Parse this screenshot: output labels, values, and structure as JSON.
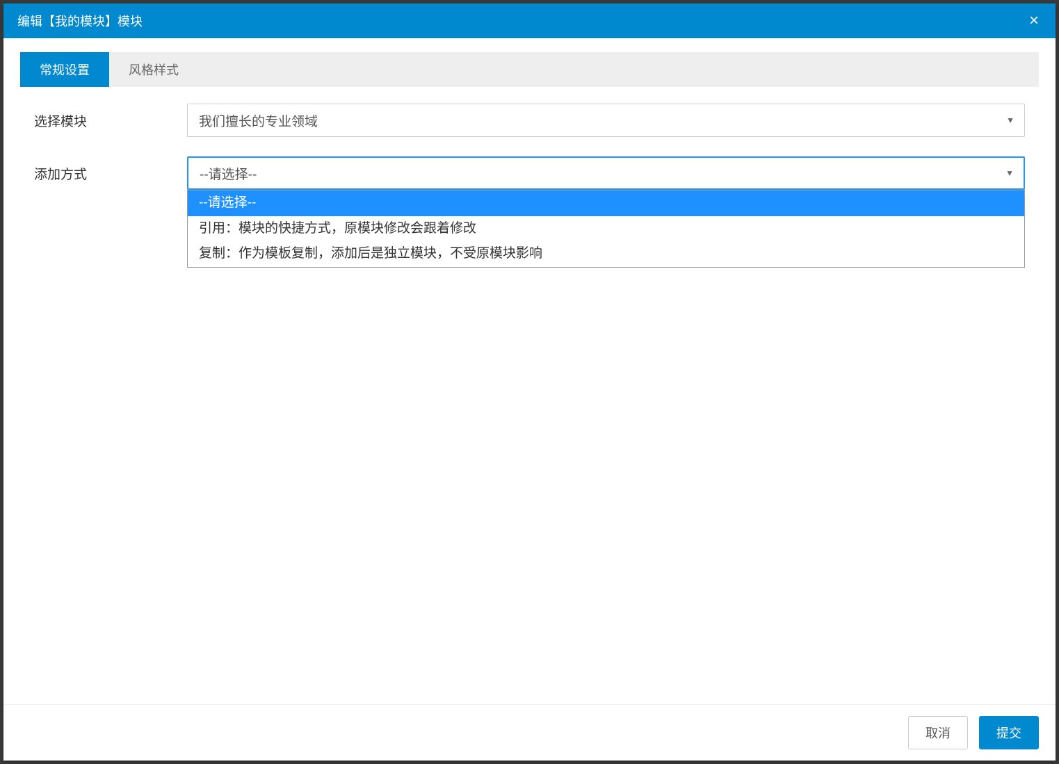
{
  "modal": {
    "title": "编辑【我的模块】模块",
    "close_icon": "×"
  },
  "tabs": [
    {
      "label": "常规设置",
      "active": true
    },
    {
      "label": "风格样式",
      "active": false
    }
  ],
  "form": {
    "select_module": {
      "label": "选择模块",
      "value": "我们擅长的专业领域"
    },
    "add_method": {
      "label": "添加方式",
      "value": "--请选择--",
      "options": [
        {
          "text": "--请选择--",
          "selected": true
        },
        {
          "text": "引用：模块的快捷方式，原模块修改会跟着修改",
          "selected": false
        },
        {
          "text": "复制：作为模板复制，添加后是独立模块，不受原模块影响",
          "selected": false
        }
      ]
    }
  },
  "footer": {
    "cancel_label": "取消",
    "submit_label": "提交"
  }
}
